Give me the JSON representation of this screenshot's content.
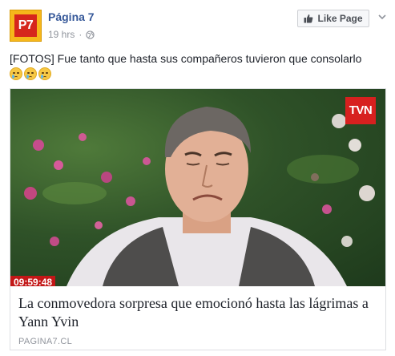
{
  "header": {
    "avatar_text": "P7",
    "page_name": "Página 7",
    "time": "19 hrs",
    "separator": "·",
    "privacy_icon": "globe-icon",
    "like_button_label": "Like Page",
    "like_icon": "thumbs-up-icon",
    "menu_icon": "chevron-down-icon"
  },
  "post": {
    "text": "[FOTOS] Fue tanto que hasta sus compañeros tuvieron que consolarlo",
    "emojis": [
      "crying-face-icon",
      "crying-face-icon",
      "crying-face-icon"
    ]
  },
  "link_card": {
    "image": {
      "channel_logo": "TVN",
      "timecode": "09:59:48"
    },
    "title": "La conmovedora sorpresa que emocionó hasta las lágrimas a Yann Yvin",
    "domain": "PAGINA7.CL"
  },
  "colors": {
    "link_blue": "#365899",
    "meta_grey": "#90949c",
    "text": "#1d2129",
    "border": "#dddfe2",
    "brand_red": "#d6261c",
    "brand_yellow": "#f6b71a"
  }
}
